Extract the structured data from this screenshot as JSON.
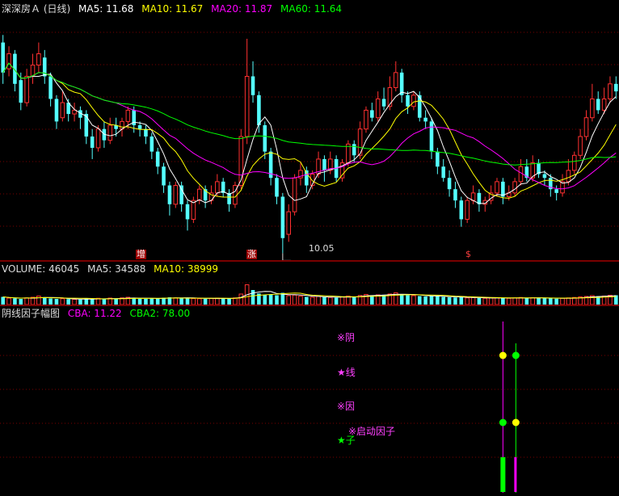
{
  "header": {
    "stock_label": "深深房Ａ (日线)",
    "ma5": "MA5: 11.68",
    "ma10": "MA10: 11.67",
    "ma20": "MA20: 11.87",
    "ma60": "MA60: 11.64"
  },
  "volume_header": {
    "volume": "VOLUME: 46045",
    "ma5": "MA5: 34588",
    "ma10": "MA10: 38999"
  },
  "indicator_header": {
    "name": "阴线因子幅图",
    "cba": "CBA: 11.22",
    "cba2": "CBA2: 78.00"
  },
  "markers": {
    "m1": "增",
    "m2": "涨",
    "m3": "$"
  },
  "low_annotation": "10.05",
  "signals": {
    "s1": "※阴",
    "s2": "★线",
    "s3": "※因",
    "s4": "※启动因子",
    "s5": "★子"
  },
  "colors": {
    "up": "#ff3030",
    "down": "#54ffff",
    "ma5": "#ffffff",
    "ma10": "#ffff00",
    "ma20": "#ff00ff",
    "ma60": "#00ff00",
    "grid": "#7a0000"
  },
  "chart_data": {
    "type": "candlestick",
    "price_ylim": [
      10.0,
      13.2
    ],
    "low_point": 10.05,
    "candles": [
      [
        12.85,
        12.45,
        12.95,
        12.3
      ],
      [
        12.5,
        12.7,
        12.8,
        12.4
      ],
      [
        12.7,
        12.3,
        12.75,
        12.2
      ],
      [
        12.35,
        12.05,
        12.45,
        11.95
      ],
      [
        12.05,
        12.4,
        12.5,
        12.0
      ],
      [
        12.4,
        12.55,
        12.7,
        12.3
      ],
      [
        12.55,
        12.7,
        12.85,
        12.45
      ],
      [
        12.65,
        12.4,
        12.75,
        12.3
      ],
      [
        12.4,
        12.1,
        12.45,
        12.0
      ],
      [
        12.1,
        11.8,
        12.15,
        11.7
      ],
      [
        11.85,
        12.05,
        12.2,
        11.8
      ],
      [
        12.05,
        11.9,
        12.1,
        11.8
      ],
      [
        11.9,
        11.95,
        12.05,
        11.8
      ],
      [
        11.95,
        11.85,
        12.0,
        11.7
      ],
      [
        11.9,
        11.6,
        11.95,
        11.5
      ],
      [
        11.6,
        11.45,
        11.7,
        11.3
      ],
      [
        11.45,
        11.7,
        11.75,
        11.4
      ],
      [
        11.7,
        11.55,
        11.8,
        11.45
      ],
      [
        11.55,
        11.75,
        11.85,
        11.5
      ],
      [
        11.75,
        11.7,
        11.85,
        11.6
      ],
      [
        11.7,
        11.8,
        11.85,
        11.6
      ],
      [
        11.8,
        11.95,
        12.0,
        11.7
      ],
      [
        11.95,
        11.75,
        12.0,
        11.65
      ],
      [
        11.75,
        11.7,
        11.8,
        11.6
      ],
      [
        11.7,
        11.6,
        11.75,
        11.5
      ],
      [
        11.6,
        11.4,
        11.65,
        11.3
      ],
      [
        11.4,
        11.2,
        11.45,
        11.1
      ],
      [
        11.2,
        10.95,
        11.25,
        10.85
      ],
      [
        10.95,
        10.7,
        11.0,
        10.55
      ],
      [
        10.7,
        10.95,
        11.0,
        10.65
      ],
      [
        10.95,
        10.7,
        11.0,
        10.6
      ],
      [
        10.7,
        10.5,
        10.75,
        10.35
      ],
      [
        10.5,
        10.75,
        10.8,
        10.45
      ],
      [
        10.75,
        10.9,
        10.95,
        10.7
      ],
      [
        10.9,
        10.75,
        10.95,
        10.65
      ],
      [
        10.75,
        10.85,
        10.95,
        10.7
      ],
      [
        10.85,
        11.0,
        11.1,
        10.8
      ],
      [
        11.0,
        10.85,
        11.05,
        10.8
      ],
      [
        10.85,
        10.7,
        10.9,
        10.6
      ],
      [
        10.7,
        10.95,
        11.0,
        10.65
      ],
      [
        10.95,
        11.6,
        11.7,
        10.9
      ],
      [
        11.6,
        12.4,
        12.9,
        11.5
      ],
      [
        12.4,
        12.15,
        12.6,
        12.05
      ],
      [
        12.15,
        11.75,
        12.2,
        11.65
      ],
      [
        11.75,
        11.4,
        11.8,
        11.3
      ],
      [
        11.4,
        11.05,
        11.45,
        10.95
      ],
      [
        11.05,
        10.8,
        11.1,
        10.7
      ],
      [
        10.8,
        10.25,
        10.85,
        10.05
      ],
      [
        10.3,
        10.6,
        10.7,
        10.2
      ],
      [
        10.6,
        11.05,
        11.1,
        10.55
      ],
      [
        11.05,
        11.15,
        11.25,
        10.95
      ],
      [
        11.15,
        10.95,
        11.2,
        10.85
      ],
      [
        10.95,
        11.1,
        11.15,
        10.9
      ],
      [
        11.1,
        11.3,
        11.4,
        11.05
      ],
      [
        11.3,
        11.15,
        11.35,
        11.0
      ],
      [
        11.15,
        11.3,
        11.4,
        11.1
      ],
      [
        11.3,
        11.05,
        11.35,
        11.0
      ],
      [
        11.05,
        11.25,
        11.3,
        11.0
      ],
      [
        11.25,
        11.5,
        11.55,
        11.2
      ],
      [
        11.5,
        11.35,
        11.55,
        11.25
      ],
      [
        11.35,
        11.7,
        11.8,
        11.3
      ],
      [
        11.7,
        11.95,
        12.0,
        11.65
      ],
      [
        11.95,
        11.85,
        12.05,
        11.8
      ],
      [
        11.85,
        12.1,
        12.2,
        11.8
      ],
      [
        12.1,
        12.0,
        12.25,
        11.95
      ],
      [
        12.0,
        12.25,
        12.4,
        11.95
      ],
      [
        12.25,
        12.45,
        12.6,
        12.2
      ],
      [
        12.45,
        12.15,
        12.5,
        12.05
      ],
      [
        12.15,
        12.0,
        12.2,
        11.9
      ],
      [
        12.0,
        12.15,
        12.2,
        11.95
      ],
      [
        12.15,
        11.85,
        12.2,
        11.8
      ],
      [
        11.85,
        11.8,
        11.95,
        11.7
      ],
      [
        11.8,
        11.4,
        11.85,
        11.3
      ],
      [
        11.4,
        11.2,
        11.45,
        11.1
      ],
      [
        11.2,
        11.05,
        11.3,
        11.0
      ],
      [
        11.05,
        10.9,
        11.15,
        10.8
      ],
      [
        10.9,
        10.75,
        11.0,
        10.65
      ],
      [
        10.75,
        10.5,
        10.8,
        10.4
      ],
      [
        10.5,
        10.75,
        10.8,
        10.45
      ],
      [
        10.75,
        10.85,
        10.95,
        10.7
      ],
      [
        10.85,
        10.7,
        10.9,
        10.6
      ],
      [
        10.7,
        10.75,
        10.8,
        10.6
      ],
      [
        10.75,
        10.85,
        10.95,
        10.7
      ],
      [
        10.85,
        11.0,
        11.05,
        10.8
      ],
      [
        11.0,
        10.8,
        11.05,
        10.7
      ],
      [
        10.8,
        10.85,
        10.95,
        10.75
      ],
      [
        10.85,
        11.0,
        11.05,
        10.8
      ],
      [
        11.0,
        11.2,
        11.3,
        10.95
      ],
      [
        11.2,
        11.05,
        11.3,
        11.0
      ],
      [
        11.05,
        11.25,
        11.35,
        11.0
      ],
      [
        11.25,
        11.1,
        11.3,
        11.05
      ],
      [
        11.1,
        11.05,
        11.15,
        10.95
      ],
      [
        11.05,
        10.9,
        11.1,
        10.8
      ],
      [
        10.9,
        10.85,
        10.95,
        10.75
      ],
      [
        10.85,
        11.0,
        11.1,
        10.8
      ],
      [
        11.0,
        11.15,
        11.3,
        10.95
      ],
      [
        11.15,
        11.35,
        11.4,
        11.1
      ],
      [
        11.35,
        11.6,
        11.7,
        11.3
      ],
      [
        11.6,
        11.85,
        11.95,
        11.55
      ],
      [
        11.85,
        12.1,
        12.3,
        11.8
      ],
      [
        12.1,
        11.95,
        12.2,
        11.9
      ],
      [
        11.95,
        12.1,
        12.25,
        11.9
      ],
      [
        12.1,
        12.3,
        12.4,
        12.05
      ],
      [
        12.3,
        12.2,
        12.4,
        12.1
      ]
    ],
    "volume_ylim": [
      0,
      140000
    ],
    "volumes": [
      38000,
      32000,
      30000,
      28000,
      33000,
      36000,
      42000,
      35000,
      30000,
      28000,
      29000,
      27000,
      26000,
      25000,
      30000,
      28000,
      31000,
      27000,
      32000,
      30000,
      33000,
      36000,
      31000,
      29000,
      28000,
      30000,
      32000,
      34000,
      36000,
      33000,
      31000,
      34000,
      30000,
      29000,
      28000,
      30000,
      32000,
      31000,
      29000,
      33000,
      52000,
      98000,
      72000,
      55000,
      48000,
      50000,
      46000,
      58000,
      44000,
      47000,
      42000,
      38000,
      36000,
      40000,
      37000,
      35000,
      34000,
      38000,
      42000,
      40000,
      45000,
      50000,
      46000,
      48000,
      47000,
      52000,
      58000,
      50000,
      46000,
      44000,
      42000,
      40000,
      43000,
      41000,
      38000,
      36000,
      35000,
      38000,
      33000,
      34000,
      32000,
      31000,
      33000,
      34000,
      32000,
      31000,
      33000,
      35000,
      32000,
      34000,
      33000,
      31000,
      30000,
      29000,
      31000,
      33000,
      35000,
      38000,
      40000,
      44000,
      41000,
      42000,
      46000,
      46045
    ],
    "indicator_signal_index": 84
  }
}
